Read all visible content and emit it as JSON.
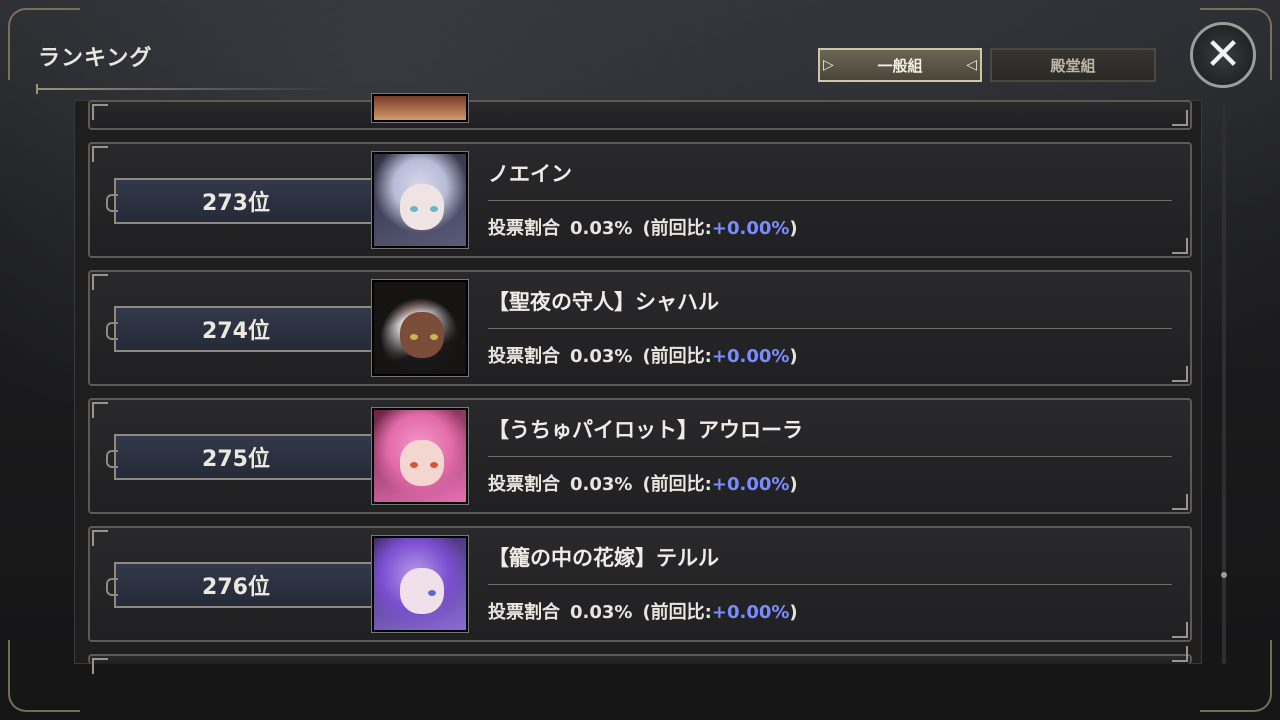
{
  "header": {
    "title": "ランキング"
  },
  "tabs": [
    {
      "label": "一般組",
      "active": true
    },
    {
      "label": "殿堂組",
      "active": false
    }
  ],
  "close_icon": "close-x-icon",
  "colors": {
    "delta": "#7b8cff",
    "accent_frame": "#8e8a80"
  },
  "rows": [
    {
      "rank": "273位",
      "name": "ノエイン",
      "vote_label": "投票割合",
      "vote_value": "0.03%",
      "prev_label": "(前回比:",
      "prev_value": "+0.00%",
      "prev_close": ")"
    },
    {
      "rank": "274位",
      "name": "【聖夜の守人】シャハル",
      "vote_label": "投票割合",
      "vote_value": "0.03%",
      "prev_label": "(前回比:",
      "prev_value": "+0.00%",
      "prev_close": ")"
    },
    {
      "rank": "275位",
      "name": "【うちゅパイロット】アウローラ",
      "vote_label": "投票割合",
      "vote_value": "0.03%",
      "prev_label": "(前回比:",
      "prev_value": "+0.00%",
      "prev_close": ")"
    },
    {
      "rank": "276位",
      "name": "【籠の中の花嫁】テルル",
      "vote_label": "投票割合",
      "vote_value": "0.03%",
      "prev_label": "(前回比:",
      "prev_value": "+0.00%",
      "prev_close": ")"
    }
  ]
}
